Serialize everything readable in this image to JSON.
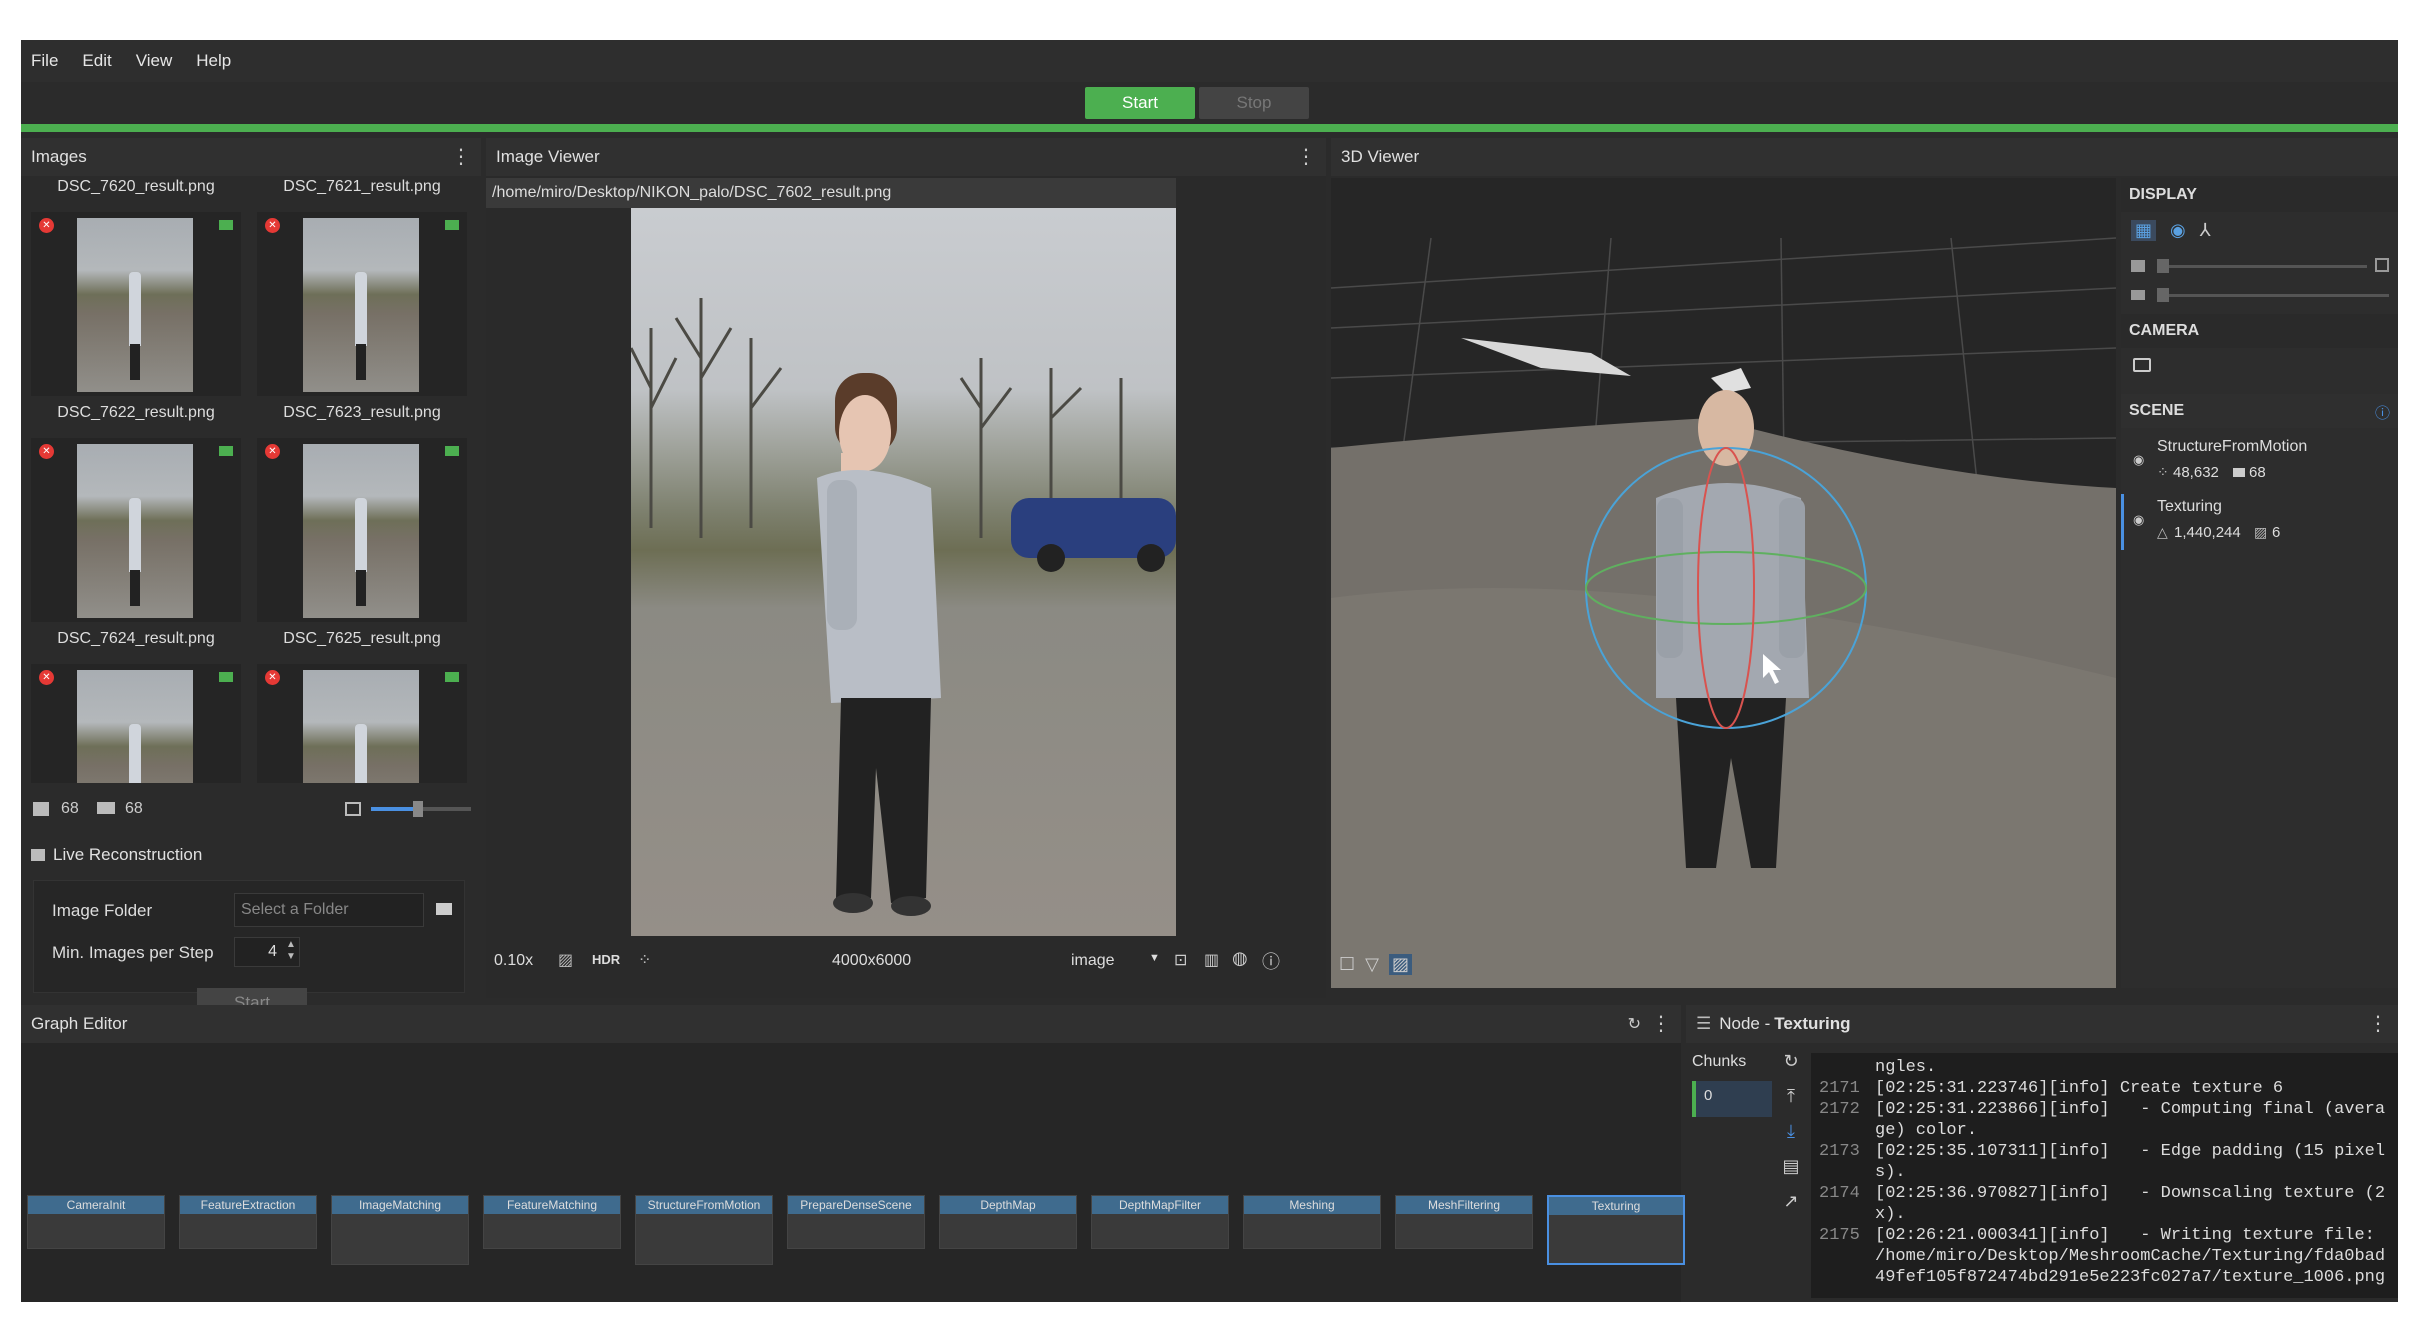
{
  "menu": [
    "File",
    "Edit",
    "View",
    "Help"
  ],
  "toolbar": {
    "start_label": "Start",
    "stop_label": "Stop"
  },
  "images_panel": {
    "title": "Images",
    "thumbnails": [
      {
        "name": "DSC_7620_result.png"
      },
      {
        "name": "DSC_7621_result.png"
      },
      {
        "name": "DSC_7622_result.png"
      },
      {
        "name": "DSC_7623_result.png"
      },
      {
        "name": "DSC_7624_result.png"
      },
      {
        "name": "DSC_7625_result.png"
      }
    ],
    "image_count": "68",
    "camera_count": "68",
    "live_title": "Live Reconstruction",
    "image_folder_label": "Image Folder",
    "image_folder_placeholder": "Select a Folder",
    "min_images_label": "Min. Images per Step",
    "min_images_value": "4",
    "live_start_label": "Start"
  },
  "image_viewer": {
    "title": "Image Viewer",
    "path": "/home/miro/Desktop/NIKON_palo/DSC_7602_result.png",
    "zoom": "0.10x",
    "hdr_label": "HDR",
    "resolution": "4000x6000",
    "channel": "image"
  },
  "viewer3d": {
    "title": "3D Viewer",
    "display_header": "DISPLAY",
    "camera_header": "CAMERA",
    "scene_header": "SCENE",
    "scene_items": [
      {
        "name": "StructureFromMotion",
        "stat1": "48,632",
        "stat2": "68"
      },
      {
        "name": "Texturing",
        "stat1": "1,440,244",
        "stat2": "6"
      }
    ]
  },
  "graph_editor": {
    "title": "Graph Editor",
    "nodes": [
      {
        "label": "CameraInit"
      },
      {
        "label": "FeatureExtraction"
      },
      {
        "label": "ImageMatching"
      },
      {
        "label": "FeatureMatching"
      },
      {
        "label": "StructureFromMotion"
      },
      {
        "label": "PrepareDenseScene"
      },
      {
        "label": "DepthMap"
      },
      {
        "label": "DepthMapFilter"
      },
      {
        "label": "Meshing"
      },
      {
        "label": "MeshFiltering"
      },
      {
        "label": "Texturing"
      }
    ]
  },
  "node_panel": {
    "title_prefix": "Node - ",
    "title_node": "Texturing",
    "chunks_label": "Chunks",
    "chunk_value": "0",
    "log_lines": [
      {
        "n": "",
        "t": "ngles."
      },
      {
        "n": "2171",
        "t": "[02:25:31.223746][info] Create texture 6"
      },
      {
        "n": "2172",
        "t": "[02:25:31.223866][info]   - Computing final (avera"
      },
      {
        "n": "",
        "t": "ge) color."
      },
      {
        "n": "2173",
        "t": "[02:25:35.107311][info]   - Edge padding (15 pixel"
      },
      {
        "n": "",
        "t": "s)."
      },
      {
        "n": "2174",
        "t": "[02:25:36.970827][info]   - Downscaling texture (2"
      },
      {
        "n": "",
        "t": "x)."
      },
      {
        "n": "2175",
        "t": "[02:26:21.000341][info]   - Writing texture file:"
      },
      {
        "n": "",
        "t": "/home/miro/Desktop/MeshroomCache/Texturing/fda0bad"
      },
      {
        "n": "",
        "t": "49fef105f872474bd291e5e223fc027a7/texture_1006.png"
      }
    ]
  },
  "colors": {
    "accent": "#4caf50",
    "error": "#e53935",
    "selection": "#4a90e2"
  }
}
